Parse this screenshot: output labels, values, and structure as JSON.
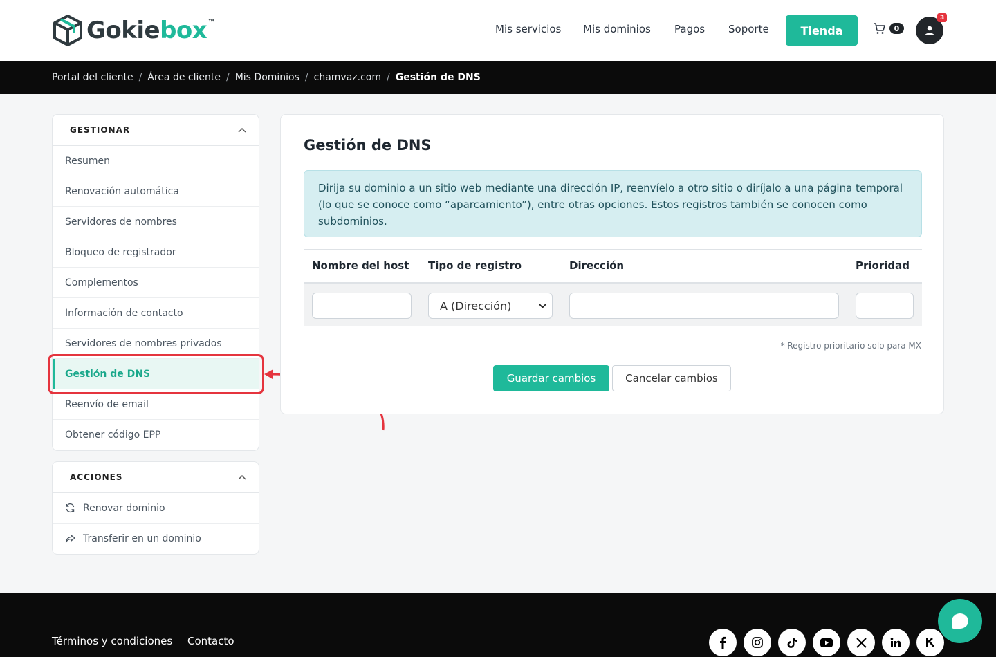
{
  "brand": {
    "part1": "Gokie",
    "part2": "box",
    "tm": "™"
  },
  "nav": {
    "items": [
      "Mis servicios",
      "Mis dominios",
      "Pagos",
      "Soporte"
    ],
    "store_button": "Tienda",
    "cart_count": "0",
    "notification_count": "3"
  },
  "breadcrumb": {
    "items": [
      "Portal del cliente",
      "Área de cliente",
      "Mis Dominios",
      "chamvaz.com"
    ],
    "current": "Gestión de DNS",
    "separator": "/"
  },
  "sidebar": {
    "manage": {
      "title": "GESTIONAR",
      "items": [
        "Resumen",
        "Renovación automática",
        "Servidores de nombres",
        "Bloqueo de registrador",
        "Complementos",
        "Información de contacto",
        "Servidores de nombres privados",
        "Gestión de DNS",
        "Reenvío de email",
        "Obtener código EPP"
      ],
      "active": "Gestión de DNS"
    },
    "actions": {
      "title": "ACCIONES",
      "items": [
        {
          "icon": "refresh-icon",
          "label": "Renovar dominio"
        },
        {
          "icon": "share-arrow-icon",
          "label": "Transferir en un dominio"
        }
      ]
    }
  },
  "main": {
    "title": "Gestión de DNS",
    "alert": "Dirija su dominio a un sitio web mediante una dirección IP, reenvíelo a otro sitio o diríjalo a una página temporal (lo que se conoce como “aparcamiento”), entre otras opciones. Estos registros también se conocen como subdominios.",
    "table": {
      "headers": [
        "Nombre del host",
        "Tipo de registro",
        "Dirección",
        "Prioridad"
      ],
      "row": {
        "host": "",
        "record_type": "A (Dirección)",
        "address": "",
        "priority": ""
      }
    },
    "note": "* Registro prioritario solo para MX",
    "save_button": "Guardar cambios",
    "cancel_button": "Cancelar cambios"
  },
  "footer": {
    "links": [
      "Términos y condiciones",
      "Contacto"
    ],
    "social": [
      "facebook-icon",
      "instagram-icon",
      "tiktok-icon",
      "youtube-icon",
      "x-icon",
      "linkedin-icon",
      "k-icon"
    ]
  },
  "colors": {
    "accent": "#1fb99a",
    "dark": "#0b0b0b",
    "highlight": "#e5343e",
    "alert_bg": "#d6eef1"
  }
}
